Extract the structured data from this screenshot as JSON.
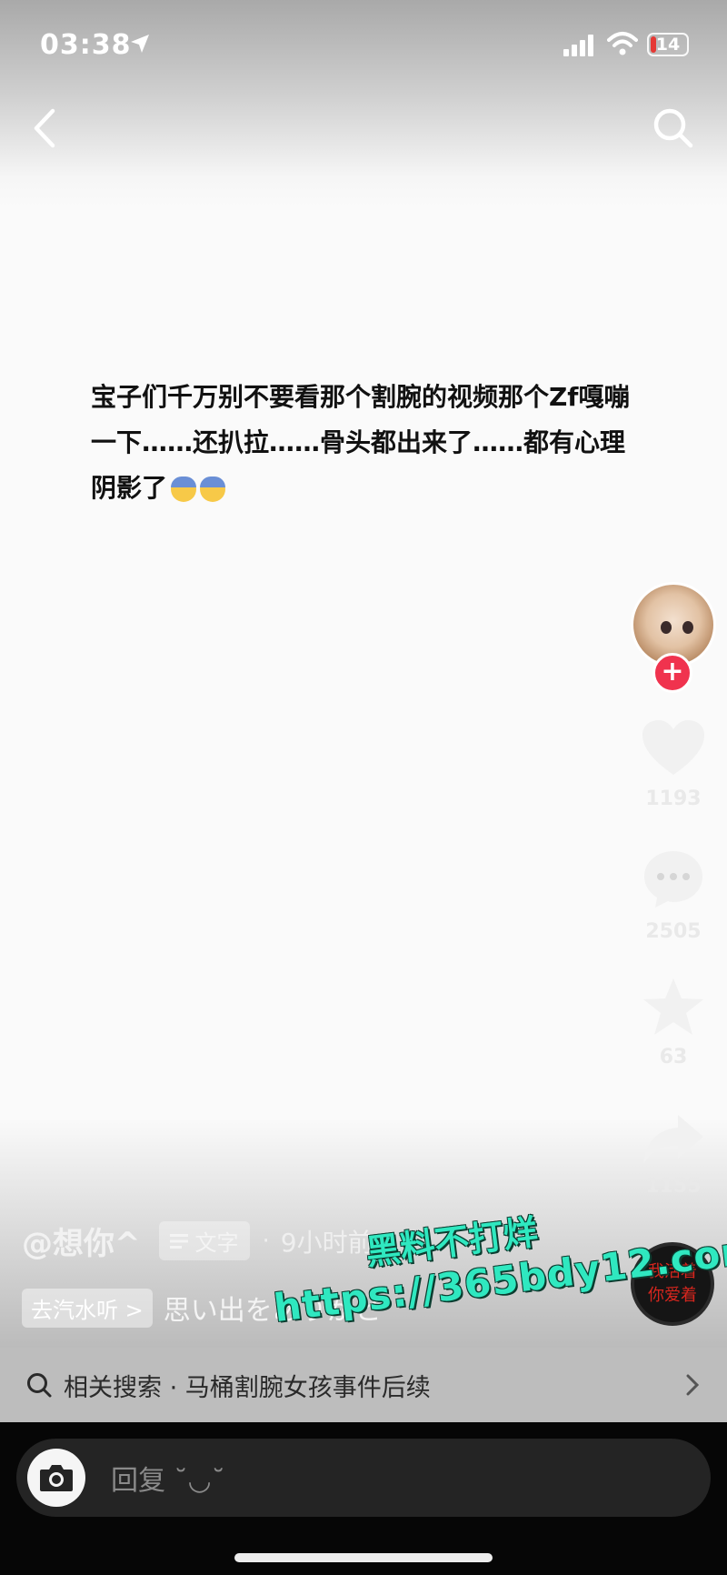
{
  "status_bar": {
    "time": "03:38",
    "battery": "14"
  },
  "post": {
    "text": "宝子们千万别不要看那个割腕的视频那个Zf嘎嘣一下……还扒拉……骨头都出来了……都有心理阴影了",
    "emojis": [
      "fearful-face-emoji",
      "scream-face-emoji"
    ]
  },
  "actions": {
    "likes": "1193",
    "comments": "2505",
    "favorites": "63",
    "shares": "1155"
  },
  "author": {
    "handle": "@想你^",
    "tag": "文字",
    "separator": "·",
    "time_ago": "9小时前"
  },
  "music": {
    "source_label": "去汽水听 >",
    "song": "思い出をありがと"
  },
  "music_disc_text": "我活着\n你爱着",
  "watermark": {
    "line1": "黑料不打烊",
    "line2": "https://365bdy12.com"
  },
  "related_search": {
    "text": "相关搜索 · 马桶割腕女孩事件后续"
  },
  "reply": {
    "placeholder": "回复 ˘◡˘"
  },
  "colors": {
    "follow": "#f0334e",
    "watermark": "#2fe8c0"
  }
}
